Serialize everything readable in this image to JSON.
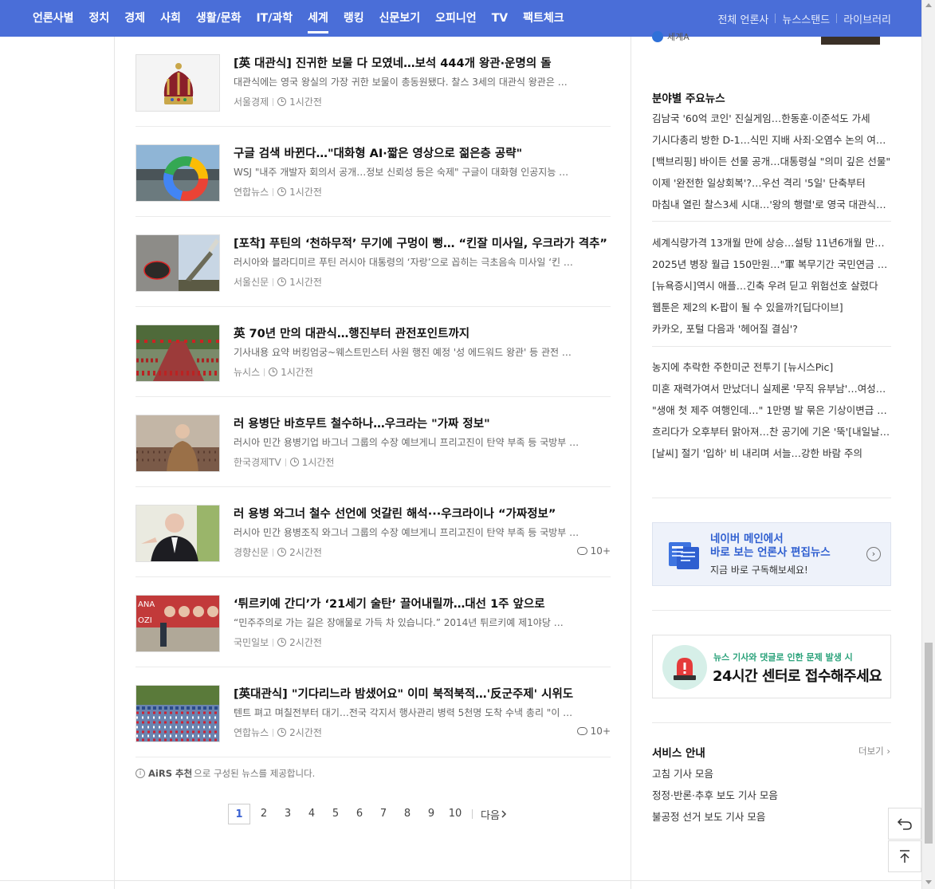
{
  "nav": {
    "categories": [
      "언론사별",
      "정치",
      "경제",
      "사회",
      "생활/문화",
      "IT/과학",
      "세계",
      "랭킹",
      "신문보기",
      "오피니언",
      "TV",
      "팩트체크"
    ],
    "active": "세계",
    "right_links": [
      "전체 언론사",
      "뉴스스탠드",
      "라이브러리"
    ]
  },
  "articles": [
    {
      "title": "[英 대관식] 진귀한 보물 다 모였네…보석 444개 왕관·운명의 돌",
      "desc": "대관식에는 영국 왕실의 가장 귀한 보물이 총동원됐다. 찰스 3세의 대관식 왕관은 …",
      "press": "서울경제",
      "time": "1시간전",
      "comments": ""
    },
    {
      "title": "구글 검색 바뀐다…\"대화형 AI·짧은 영상으로 젊은층 공략\"",
      "desc": "WSJ \"내주 개발자 회의서 공개…정보 신뢰성 등은 숙제\" 구글이 대화형 인공지능 …",
      "press": "연합뉴스",
      "time": "1시간전",
      "comments": ""
    },
    {
      "title": "[포착] 푸틴의 ‘천하무적’ 무기에 구멍이 뻥… “킨잘 미사일, 우크라가 격추”",
      "desc": "러시아와 블라디미르 푸틴 러시아 대통령의 ‘자랑’으로 꼽히는 극초음속 미사일 ‘킨 …",
      "press": "서울신문",
      "time": "1시간전",
      "comments": ""
    },
    {
      "title": "英 70년 만의 대관식…행진부터 관전포인트까지",
      "desc": "기사내용 요약 버킹엄궁~웨스트민스터 사원 행진 예정 '성 에드워드 왕관' 등 관전 …",
      "press": "뉴시스",
      "time": "1시간전",
      "comments": ""
    },
    {
      "title": "러 용병단 바흐무트 철수하나…우크라는 \"가짜 정보\"",
      "desc": "러시아 민간 용병기업 바그너 그룹의 수장 예브게니 프리고진이 탄약 부족 등 국방부 …",
      "press": "한국경제TV",
      "time": "1시간전",
      "comments": ""
    },
    {
      "title": "러 용병 와그너 철수 선언에 엇갈린 해석···우크라이나 “가짜정보”",
      "desc": "러시아 민간 용병조직 와그너 그룹의 수장 예브게니 프리고진이 탄약 부족 등 국방부 …",
      "press": "경향신문",
      "time": "2시간전",
      "comments": "10+"
    },
    {
      "title": "‘튀르키예 간디’가 ‘21세기 술탄’ 끌어내릴까…대선 1주 앞으로",
      "desc": "“민주주의로 가는 길은 장애물로 가득 차 있습니다.” 2014년 튀르키예 제1야당 …",
      "press": "국민일보",
      "time": "2시간전",
      "comments": ""
    },
    {
      "title": "[英대관식] \"기다리느라 밤샜어요\" 이미 북적북적…'反군주제' 시위도",
      "desc": "텐트 펴고 며칠전부터 대기…전국 각지서 행사관리 병력 5천명 도착 수낵 총리 \"이 …",
      "press": "연합뉴스",
      "time": "2시간전",
      "comments": "10+"
    }
  ],
  "airs_note": {
    "bold": "AiRS 추천",
    "rest": "으로 구성된 뉴스를 제공합니다."
  },
  "pager": {
    "pages": [
      "1",
      "2",
      "3",
      "4",
      "5",
      "6",
      "7",
      "8",
      "9",
      "10"
    ],
    "current": "1",
    "next": "다음"
  },
  "sidebar": {
    "top_partial": "세계A",
    "section_title": "분야별 주요뉴스",
    "groups": [
      [
        "김남국 '60억 코인' 진실게임…한동훈·이준석도 가세",
        "기시다총리 방한 D-1…식민 지배 사죄·오염수 논의 여부…",
        "[백브리핑] 바이든 선물 공개…대통령실 \"의미 깊은 선물\"",
        "이제 '완전한 일상회복'?…우선 격리 '5일' 단축부터",
        "마침내 열린 찰스3세 시대…'왕의 행렬'로 영국 대관식…"
      ],
      [
        "세계식량가격 13개월 만에 상승…설탕 11년6개월 만에 …",
        "2025년 병장 월급 150만원…\"軍 복무기간 국민연금 강…",
        "[뉴욕증시]역시 애플…긴축 우려 딛고 위험선호 살렸다",
        "웹툰은 제2의 K-팝이 될 수 있을까?[딥다이브]",
        "카카오, 포털 다음과 '헤어질 결심'?"
      ],
      [
        "농지에 추락한 주한미군 전투기 [뉴시스Pic]",
        "미혼 재력가여서 만났더니 실제론 '무직 유부남'…여성…",
        "\"생애 첫 제주 여행인데…\" 1만명 발 묶은 기상이변급 …",
        "흐리다가 오후부터 맑아져…찬 공기에 기온 '뚝'[내일날…",
        "[날씨] 절기 '입하' 비 내리며 서늘…강한 바람 주의"
      ]
    ],
    "banner1": {
      "line1": "네이버 메인에서",
      "line2": "바로 보는 언론사 편집뉴스",
      "line3": "지금 바로 구독해보세요!"
    },
    "banner2": {
      "line1": "뉴스 기사와 댓글로 인한 문제 발생 시",
      "line2": "24시간 센터로 접수해주세요"
    },
    "service": {
      "title": "서비스 안내",
      "more": "더보기",
      "links": [
        "고침 기사 모음",
        "정정·반론·추후 보도 기사 모음",
        "불공정 선거 보도 기사 모음"
      ]
    }
  },
  "icons": [
    "clock-icon",
    "comment-icon",
    "info-icon",
    "chevron-right-icon",
    "undo-icon",
    "scroll-top-icon",
    "newspaper-icon",
    "siren-icon"
  ],
  "colors": {
    "nav_bg": "#4a6ed8",
    "accent": "#3b62d2",
    "green": "#2aa27a"
  }
}
